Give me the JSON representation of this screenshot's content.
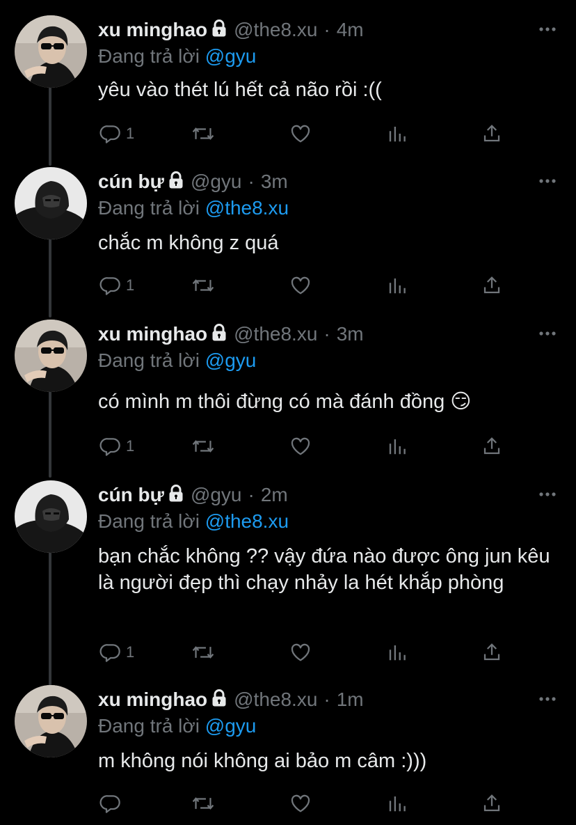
{
  "tweets": [
    {
      "name": "xu minghao",
      "handle": "@the8.xu",
      "time": "4m",
      "reply_prefix": "Đang trả lời ",
      "reply_to": "@gyu",
      "text": "yêu vào thét lú hết cả não rồi :((",
      "reply_count": "1",
      "avatar": "minghao"
    },
    {
      "name": "cún bự",
      "handle": "@gyu",
      "time": "3m",
      "reply_prefix": "Đang trả lời ",
      "reply_to": "@the8.xu",
      "text": "chắc m không z quá",
      "reply_count": "1",
      "avatar": "gyu"
    },
    {
      "name": "xu minghao",
      "handle": "@the8.xu",
      "time": "3m",
      "reply_prefix": "Đang trả lời ",
      "reply_to": "@gyu",
      "text": "có mình m thôi đừng có mà đánh đồng 😏",
      "reply_count": "1",
      "avatar": "minghao"
    },
    {
      "name": "cún bự",
      "handle": "@gyu",
      "time": "2m",
      "reply_prefix": "Đang trả lời ",
      "reply_to": "@the8.xu",
      "text": "bạn chắc không ?? vậy đứa nào được ông jun kêu là người đẹp thì chạy nhảy la hét khắp phòng",
      "reply_count": "1",
      "avatar": "gyu"
    },
    {
      "name": "xu minghao",
      "handle": "@the8.xu",
      "time": "1m",
      "reply_prefix": "Đang trả lời ",
      "reply_to": "@gyu",
      "text": "m không nói không ai bảo m câm :)))",
      "reply_count": "",
      "avatar": "minghao"
    }
  ],
  "separator": "·",
  "icons": {
    "lock": "lock-icon",
    "more": "more-icon",
    "reply": "reply-icon",
    "retweet": "retweet-icon",
    "like": "like-icon",
    "analytics": "analytics-icon",
    "share": "share-icon"
  },
  "colors": {
    "background": "#000000",
    "text": "#e7e9ea",
    "muted": "#71767b",
    "mention": "#1d9bf0",
    "thread_line": "#333639"
  }
}
